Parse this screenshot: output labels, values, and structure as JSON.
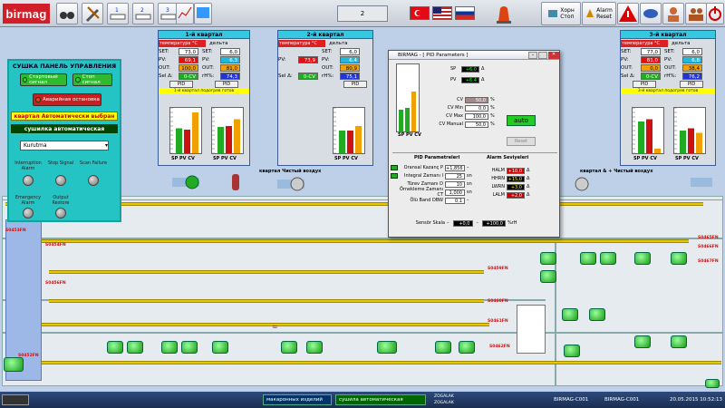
{
  "toolbar": {
    "logo": "birmag",
    "page_number": "2",
    "stop_label1": "Хорн",
    "stop_label2": "Стоп",
    "alarm_label1": "Alarm",
    "alarm_label2": "Reset"
  },
  "control_panel": {
    "title": "СУШКА ПАНЕЛЬ УПРАВЛЕНИЯ",
    "start": "Стартовый сигнал",
    "stop": "Стоп сигнал",
    "emergency": "Аварийная остановка",
    "banner1": "квартал Автоматически выбран",
    "banner2": "сушилка автоматическая",
    "select_value": "Kurutma",
    "alarms": [
      {
        "label": "Interruption Alarm"
      },
      {
        "label": "Stop Signal"
      },
      {
        "label": "Scan Failure"
      },
      {
        "label": "Emergency Alarm"
      },
      {
        "label": "Output Restore"
      }
    ]
  },
  "zones": [
    {
      "title": "1-й квартал",
      "hdr_l": "температура °C",
      "hdr_r": "дельта",
      "set": "73,0",
      "pv": "69,1",
      "out": "100,0",
      "sel": "0-CV",
      "set_r": "6,0",
      "pv_r": "6,3",
      "out_r": "81,0",
      "rh": "74,3",
      "pid": "PID",
      "banner": "1-й квартал подогрев готов",
      "bars": [
        {
          "sp": 0.55,
          "pv": 0.52,
          "cv": 0.9
        },
        {
          "sp": 0.58,
          "pv": 0.6,
          "cv": 0.75
        }
      ]
    },
    {
      "title": "2-й квартал",
      "hdr_l": "температура °C",
      "hdr_r": "дельта",
      "set": "",
      "pv": "73,9",
      "out": "",
      "sel": "0-CV",
      "set_r": "6,0",
      "pv_r": "6,4",
      "out_r": "80,9",
      "rh": "75,1",
      "pid": "PID",
      "banner": "",
      "bars": [
        {
          "sp": 0.5,
          "pv": 0.5,
          "cv": 0.6
        }
      ]
    },
    {
      "title": "3-й квартал",
      "hdr_l": "температура °C",
      "hdr_r": "дельта",
      "set": "77,0",
      "pv": "81,0",
      "out": "0,0",
      "sel": "0-CV",
      "set_r": "6,0",
      "pv_r": "6,8",
      "out_r": "38,4",
      "rh": "76,2",
      "pid": "PID",
      "banner": "3-й квартал подогрев готов",
      "bars": [
        {
          "sp": 0.7,
          "pv": 0.75,
          "cv": 0.1
        },
        {
          "sp": 0.5,
          "pv": 0.55,
          "cv": 0.45
        }
      ]
    }
  ],
  "bar_labels": {
    "sp": "SP",
    "pv": "PV",
    "cv": "CV"
  },
  "fan_label1": "квартал Чистый воздух",
  "fan_label2": "квартал & + Чистый воздух",
  "dialog": {
    "title": "BIRMAG - [ PID Parameters ]",
    "sp": "+6,0",
    "pv": "+6,4",
    "cv": "50,0",
    "cvmin": "0,0",
    "cvmax": "100,0",
    "cvmanual": "50,0",
    "auto_label": "auto",
    "reset_label": "Reset",
    "pid_title": "PID Parametreleri",
    "alarm_title": "Alarm Seviyeleri",
    "pid": [
      {
        "l": "Oransal Kazanç P",
        "v": "+1,856"
      },
      {
        "l": "Integral Zamanı I",
        "v": "25",
        "u": "sn"
      },
      {
        "l": "Türev Zamanı D",
        "v": "10",
        "u": "sn"
      },
      {
        "l": "Örnekleme Zamanı CT",
        "v": "1,000",
        "u": "sn"
      },
      {
        "l": "Ölü Band DBW",
        "v": "0,1"
      }
    ],
    "alarms": [
      {
        "l": "HALM",
        "v": "+10,0"
      },
      {
        "l": "HHRN",
        "v": "+15,0"
      },
      {
        "l": "LWRN",
        "v": "+3,0"
      },
      {
        "l": "LALM",
        "v": "+2,0"
      }
    ],
    "scale_label": "Sensör Skala",
    "scale_min": "+0,0",
    "scale_max": "+100,0",
    "scale_unit": "%rH"
  },
  "tags": [
    "S0453FN",
    "S0453FN",
    "S0454FN",
    "S0456FN",
    "S0459FN",
    "S0460FN",
    "S0461FN",
    "S0465FN",
    "S0466FN",
    "S0467FN",
    "S0452FN",
    "S0462FN"
  ],
  "taskbar": {
    "t1": "макаронных изделий",
    "t2": "сушила автоматическая",
    "t3": "ZOGALAK",
    "t4": "ZOGALAK",
    "w1": "BIRMAG-C001",
    "w2": "BIRMAG-C001",
    "clock": "20.05.2015 10:52:13"
  }
}
